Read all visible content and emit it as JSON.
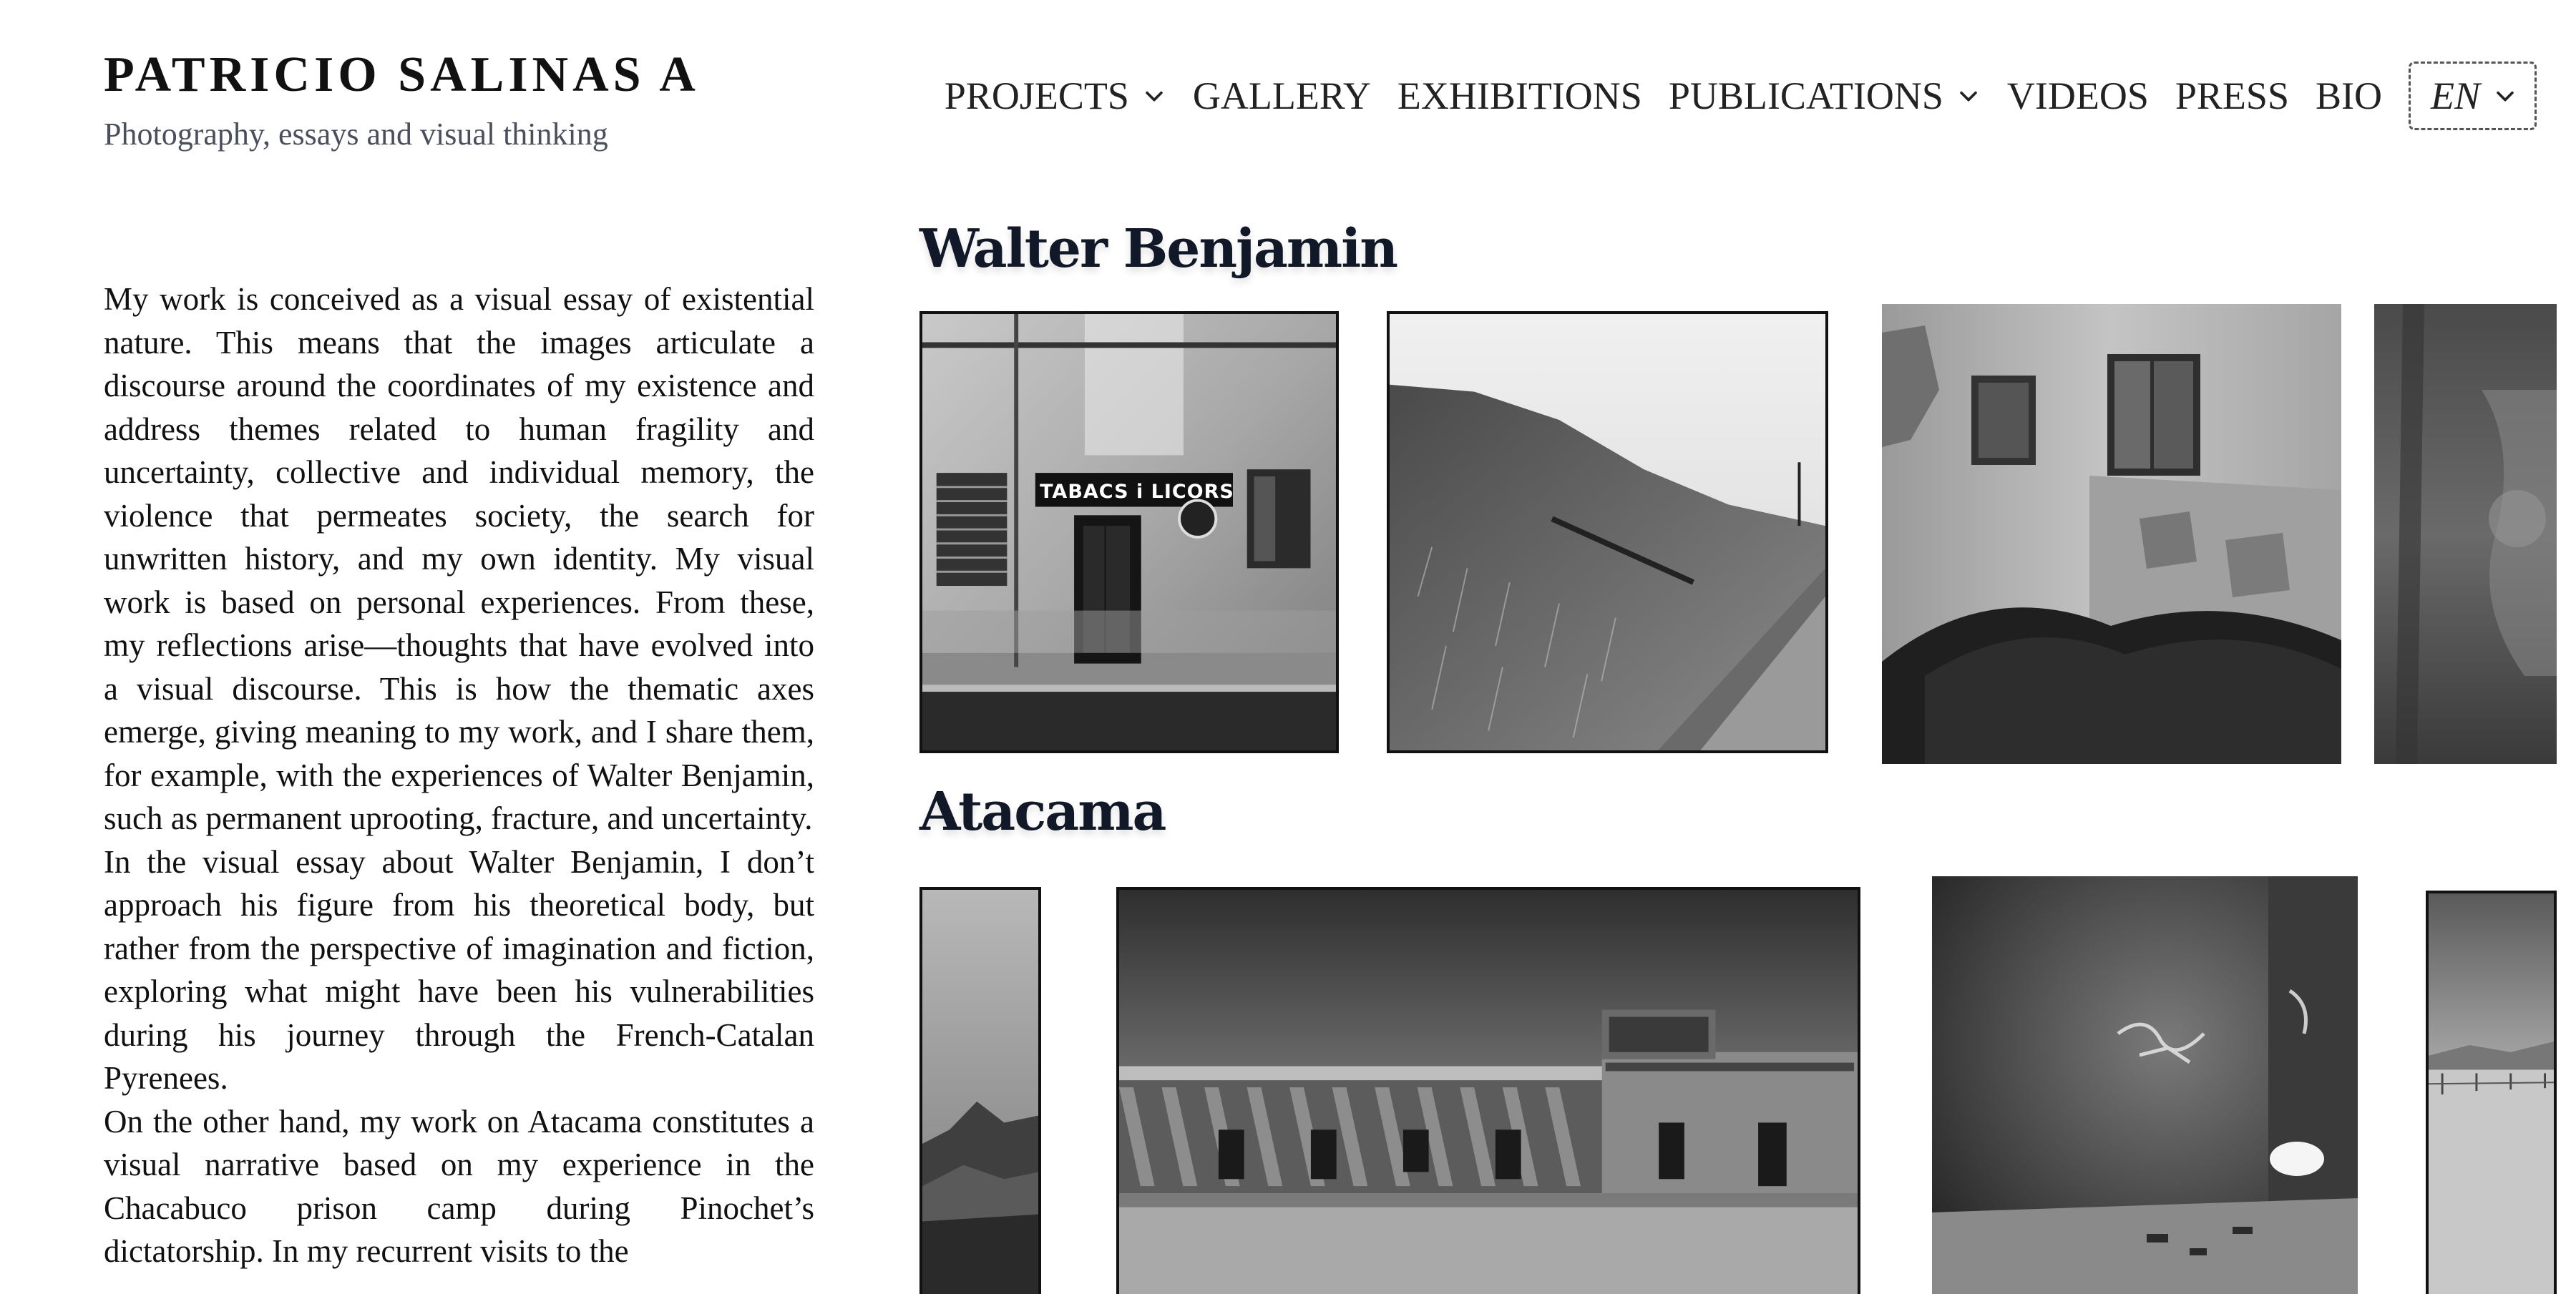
{
  "site": {
    "title": "PATRICIO SALINAS A",
    "tagline": "Photography, essays and visual thinking"
  },
  "nav": {
    "items": [
      {
        "label": "PROJECTS",
        "has_dropdown": true
      },
      {
        "label": "GALLERY",
        "has_dropdown": false
      },
      {
        "label": "EXHIBITIONS",
        "has_dropdown": false
      },
      {
        "label": "PUBLICATIONS",
        "has_dropdown": true
      },
      {
        "label": "VIDEOS",
        "has_dropdown": false
      },
      {
        "label": "PRESS",
        "has_dropdown": false
      },
      {
        "label": "BIO",
        "has_dropdown": false
      }
    ],
    "language": "EN"
  },
  "essay": {
    "paragraphs": [
      "My work is conceived as a visual essay of existential nature. This means that the images articulate a discourse around the coordinates of my existence and address themes related to human fragility and uncertainty, collective and individual memory, the violence that permeates society, the search for unwritten history, and my own identity. My visual work is based on personal experiences. From these, my reflections arise—thoughts that have evolved into a visual discourse. This is how the thematic axes emerge, giving meaning to my work, and I share them, for example, with the experiences of Walter Benjamin, such as permanent uprooting, fracture, and uncertainty.",
      "In the visual essay about Walter Benjamin, I don’t approach his figure from his theoretical body, but rather from the perspective of imagination and fiction, exploring what might have been his vulnerabilities during his journey through the French-Catalan Pyrenees.",
      "On the other hand, my work on Atacama constitutes a visual narrative based on my experience in the Chacabuco prison camp during Pinochet’s dictatorship. In my recurrent visits to the"
    ]
  },
  "sections": [
    {
      "title": "Walter Benjamin",
      "photos": [
        {
          "subject": "shop-facade",
          "sign_text": "TABACS i LICORS"
        },
        {
          "subject": "hillside-road"
        },
        {
          "subject": "ruined-house"
        },
        {
          "subject": "stained-wall"
        }
      ]
    },
    {
      "title": "Atacama",
      "photos": [
        {
          "subject": "desert-mountains"
        },
        {
          "subject": "barracks-building"
        },
        {
          "subject": "graffiti-wall"
        },
        {
          "subject": "desert-plain"
        }
      ]
    }
  ],
  "icons": {
    "dropdown": "chevron-down-icon"
  }
}
